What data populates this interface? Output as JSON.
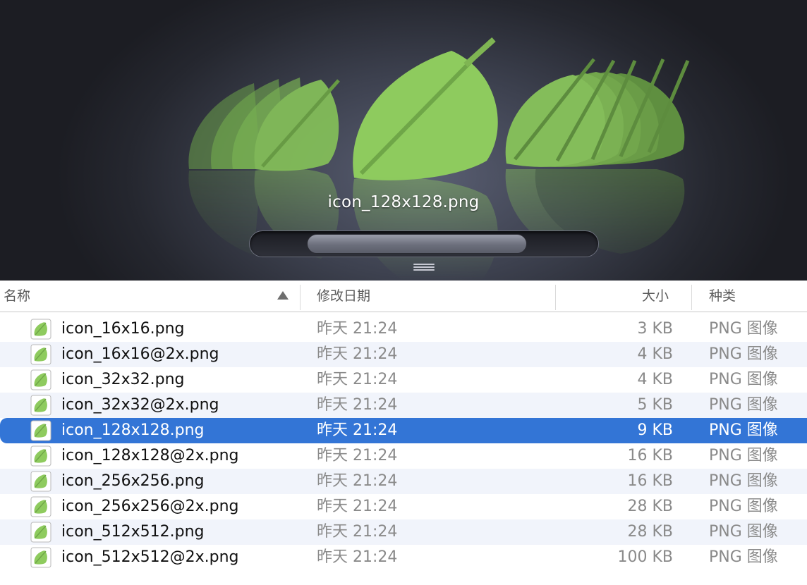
{
  "preview": {
    "title": "icon_128x128.png"
  },
  "columns": {
    "name": "名称",
    "date": "修改日期",
    "size": "大小",
    "kind": "种类"
  },
  "files": [
    {
      "name": "icon_16x16.png",
      "date": "昨天 21:24",
      "size": "3 KB",
      "kind": "PNG 图像"
    },
    {
      "name": "icon_16x16@2x.png",
      "date": "昨天 21:24",
      "size": "4 KB",
      "kind": "PNG 图像"
    },
    {
      "name": "icon_32x32.png",
      "date": "昨天 21:24",
      "size": "4 KB",
      "kind": "PNG 图像"
    },
    {
      "name": "icon_32x32@2x.png",
      "date": "昨天 21:24",
      "size": "5 KB",
      "kind": "PNG 图像"
    },
    {
      "name": "icon_128x128.png",
      "date": "昨天 21:24",
      "size": "9 KB",
      "kind": "PNG 图像"
    },
    {
      "name": "icon_128x128@2x.png",
      "date": "昨天 21:24",
      "size": "16 KB",
      "kind": "PNG 图像"
    },
    {
      "name": "icon_256x256.png",
      "date": "昨天 21:24",
      "size": "16 KB",
      "kind": "PNG 图像"
    },
    {
      "name": "icon_256x256@2x.png",
      "date": "昨天 21:24",
      "size": "28 KB",
      "kind": "PNG 图像"
    },
    {
      "name": "icon_512x512.png",
      "date": "昨天 21:24",
      "size": "28 KB",
      "kind": "PNG 图像"
    },
    {
      "name": "icon_512x512@2x.png",
      "date": "昨天 21:24",
      "size": "100 KB",
      "kind": "PNG 图像"
    }
  ],
  "selected_index": 4,
  "colors": {
    "selection": "#3375d6",
    "leaf": "#8ecb5e"
  },
  "icons": {
    "file": "leaf-png-icon",
    "sort": "sort-ascending-icon"
  }
}
